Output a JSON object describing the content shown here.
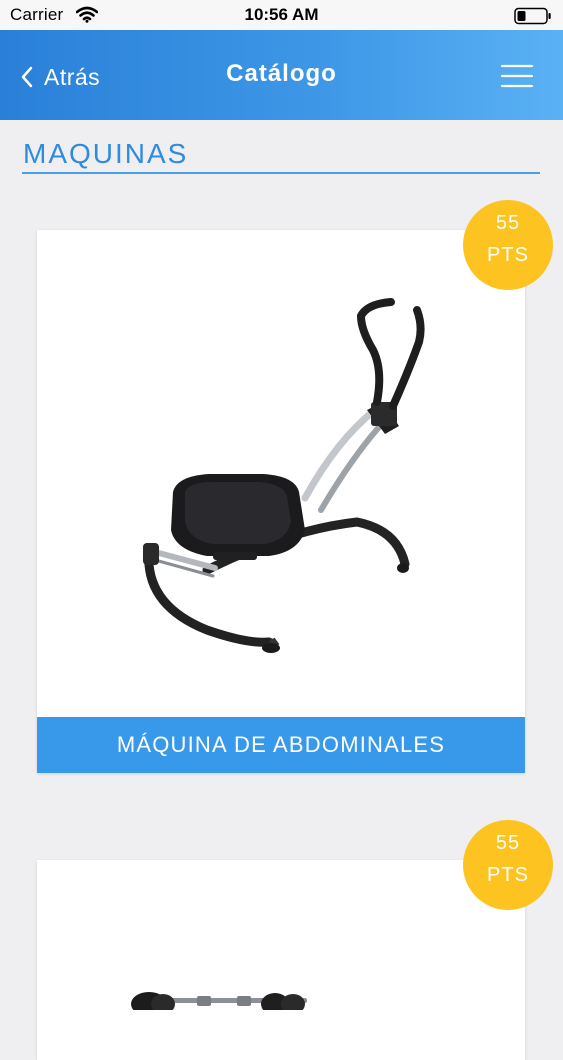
{
  "status_bar": {
    "carrier": "Carrier",
    "time": "10:56 AM",
    "wifi_icon": "wifi-icon",
    "battery_icon": "battery-icon"
  },
  "nav": {
    "back_label": "Atrás",
    "title": "Catálogo",
    "back_icon": "chevron-left-icon",
    "menu_icon": "hamburger-menu-icon",
    "gradient_start": "#2a80d8",
    "gradient_end": "#5ab1f4"
  },
  "section": {
    "title": "MAQUINAS",
    "color": "#2f8be0"
  },
  "products": [
    {
      "name": "MÁQUINA DE ABDOMINALES",
      "points_value": "55",
      "points_unit": "PTS",
      "image_icon": "ab-machine-image"
    },
    {
      "name": "",
      "points_value": "55",
      "points_unit": "PTS",
      "image_icon": "barbell-image"
    }
  ],
  "colors": {
    "badge": "#fdc320",
    "name_bar": "#3899ea",
    "background": "#efeff1"
  }
}
